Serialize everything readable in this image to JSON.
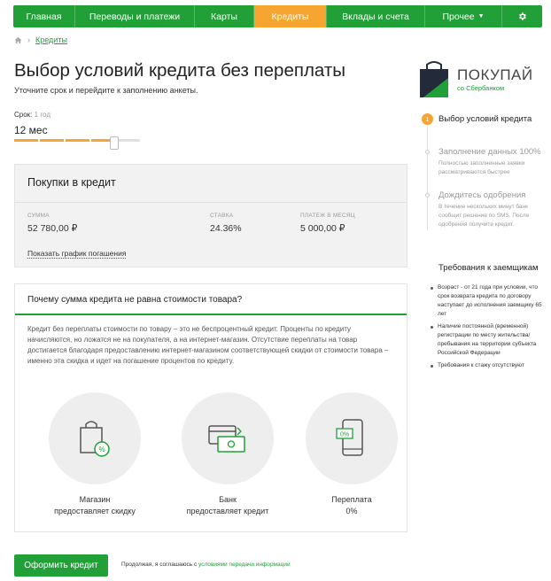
{
  "nav": {
    "items": [
      {
        "label": "Главная"
      },
      {
        "label": "Переводы и платежи"
      },
      {
        "label": "Карты"
      },
      {
        "label": "Кредиты"
      },
      {
        "label": "Вклады и счета"
      },
      {
        "label": "Прочее"
      }
    ],
    "active": "Кредиты"
  },
  "breadcrumb": {
    "link": "Кредиты"
  },
  "page": {
    "title": "Выбор условий кредита без переплаты",
    "subtitle": "Уточните срок и перейдите к заполнению анкеты."
  },
  "term": {
    "label": "Срок:",
    "hint": "1 год",
    "value": "12 мес"
  },
  "card": {
    "title": "Покупки в кредит",
    "sum_label": "Сумма",
    "sum_value": "52 780,00 ₽",
    "rate_label": "Ставка",
    "rate_value": "24.36%",
    "payment_label": "Платеж в месяц",
    "payment_value": "5 000,00 ₽",
    "schedule_link": "Показать график погашения"
  },
  "info": {
    "question": "Почему сумма кредита не равна стоимости товара?",
    "text": "Кредит без переплаты стоимости по товару – это не беспроцентный кредит. Проценты по кредиту начисляются, но ложатся не на покупателя, а на интернет-магазин. Отсутствие переплаты на товар достигается благодаря предоставлению интернет-магазином соответствующей скидки от стоимости товара – именно эта скидка и идет на погашение процентов по кредиту.",
    "features": [
      {
        "line1": "Магазин",
        "line2": "предоставляет скидку",
        "icon": "shopping-bag-percent-icon"
      },
      {
        "line1": "Банк",
        "line2": "предоставляет кредит",
        "icon": "cards-cash-icon"
      },
      {
        "line1": "Переплата",
        "line2": "0%",
        "icon": "phone-percent-icon"
      }
    ]
  },
  "logo": {
    "title": "ПОКУПАЙ",
    "subtitle": "со Сбербанком"
  },
  "steps": [
    {
      "num": "1",
      "title": "Выбор условий кредита",
      "desc": ""
    },
    {
      "num": "",
      "title": "Заполнение данных 100%",
      "desc": "Полностью заполненные заявки рассматриваются быстрее"
    },
    {
      "num": "",
      "title": "Дождитесь одобрения",
      "desc": "В течение нескольких минут банк сообщит решение по SMS. После одобрения получите кредит."
    }
  ],
  "requirements": {
    "title": "Требования к заемщикам",
    "items": [
      "Возраст - от 21 года при условии, что срок возврата кредита по договору наступает до исполнения заемщику 65 лет",
      "Наличие постоянной (временной) регистрации по месту жительства/ пребывания на территории субъекта Российской Федерации",
      "Требования к стажу отсутствуют"
    ]
  },
  "footer": {
    "submit": "Оформить кредит",
    "agree_text": "Продолжая, я соглашаюсь с",
    "agree_link": "условиями передачи информации"
  },
  "colors": {
    "brand": "#21a038",
    "accent": "#f7a531"
  }
}
